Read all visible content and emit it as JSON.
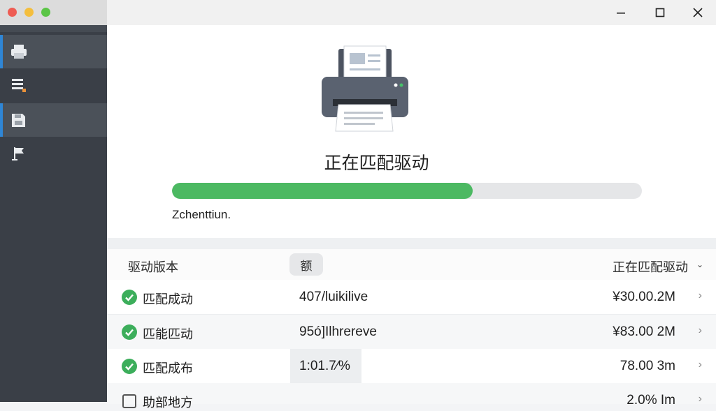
{
  "sidebar": {
    "items": [
      {
        "icon": "printer-icon",
        "active": true
      },
      {
        "icon": "list-icon",
        "active": false
      },
      {
        "icon": "save-icon",
        "active": true
      },
      {
        "icon": "flag-icon",
        "active": false
      }
    ]
  },
  "status": {
    "title": "正在匹配驱动",
    "progress": 0.64,
    "subtitle": "Zchenttiun."
  },
  "table": {
    "headers": {
      "col1": "驱动版本",
      "col2": "额",
      "col3": "正在匹配驱动"
    },
    "rows": [
      {
        "name": "匹配成动",
        "version": "407/luikilive",
        "size": "¥30.00.2M",
        "checked": true
      },
      {
        "name": "匹能匹动",
        "version": "95ó]Ilhrereve",
        "size": "¥83.00 2M",
        "checked": true
      },
      {
        "name": "匹配成布",
        "version": "1:01.7⁄%",
        "size": "78.00 3m",
        "checked": true
      },
      {
        "name": "助部地方",
        "version": "",
        "size": "2.0% Im",
        "checked": false
      }
    ]
  },
  "colors": {
    "accent": "#4cb962",
    "sidebar": "#3a3f47",
    "active_marker": "#2f86d6"
  }
}
